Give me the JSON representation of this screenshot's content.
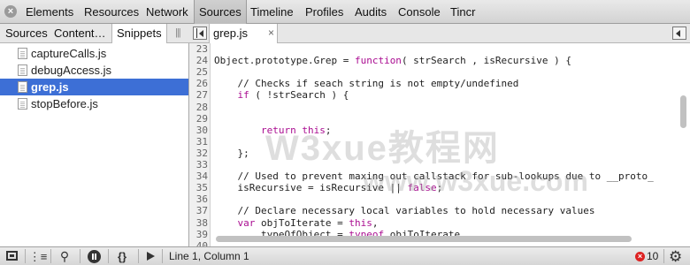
{
  "toolbar": {
    "close_icon": "close-circle-icon",
    "tabs": [
      "Elements",
      "Resources",
      "Network",
      "Sources",
      "Timeline",
      "Profiles",
      "Audits",
      "Console",
      "Tincr"
    ],
    "active_tab": "Sources"
  },
  "navigator": {
    "tabs": [
      "Sources",
      "Content…",
      "Snippets"
    ],
    "active_tab": "Snippets",
    "files": [
      "captureCalls.js",
      "debugAccess.js",
      "grep.js",
      "stopBefore.js"
    ],
    "selected_file": "grep.js"
  },
  "editor": {
    "open_tab": "grep.js",
    "close_glyph": "×",
    "lines": [
      {
        "n": "23",
        "text": ""
      },
      {
        "n": "24",
        "text": "Object.prototype.Grep = function( strSearch , isRecursive ) {"
      },
      {
        "n": "25",
        "text": ""
      },
      {
        "n": "26",
        "text": "    // Checks if seach string is not empty/undefined"
      },
      {
        "n": "27",
        "text": "    if ( !strSearch ) {"
      },
      {
        "n": "28",
        "text": ""
      },
      {
        "n": "29",
        "text": ""
      },
      {
        "n": "30",
        "text": "        return this;"
      },
      {
        "n": "31",
        "text": ""
      },
      {
        "n": "32",
        "text": "    };"
      },
      {
        "n": "33",
        "text": ""
      },
      {
        "n": "34",
        "text": "    // Used to prevent maxing out callstack for sub-lookups due to __proto_"
      },
      {
        "n": "35",
        "text": "    isRecursive = isRecursive || false;"
      },
      {
        "n": "36",
        "text": ""
      },
      {
        "n": "37",
        "text": "    // Declare necessary local variables to hold necessary values"
      },
      {
        "n": "38",
        "text": "    var objToIterate = this,"
      },
      {
        "n": "39",
        "text": "        typeOfObject = typeof objToIterate,"
      },
      {
        "n": "40",
        "text": ""
      }
    ]
  },
  "watermark": {
    "main": "W3xue教程网",
    "url": "www.w3xue.com"
  },
  "statusbar": {
    "cursor_position": "Line 1, Column 1",
    "error_count": "10",
    "format_label": "{}",
    "icons": [
      "dock-icon",
      "show-console-icon",
      "search-icon",
      "pause-exceptions-icon",
      "pretty-print-icon",
      "play-icon",
      "error-icon",
      "gear-icon"
    ]
  },
  "colors": {
    "selection": "#3d6fd6",
    "comment": "#236e25",
    "keyword": "#aa0d91",
    "error": "#dd2222"
  }
}
